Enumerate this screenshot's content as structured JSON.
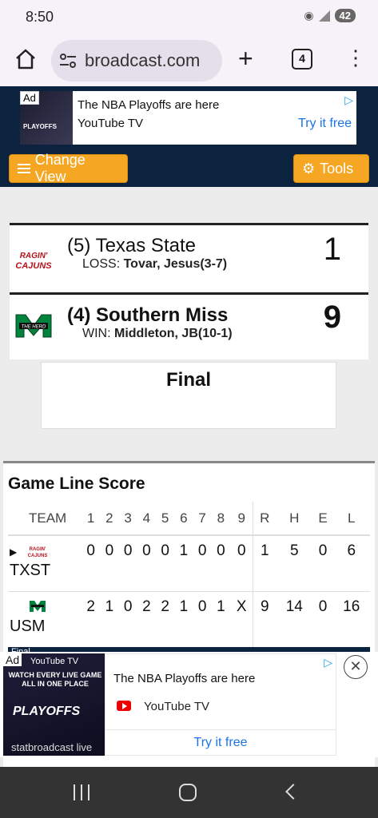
{
  "status": {
    "time": "8:50",
    "battery": "42"
  },
  "browser": {
    "url": "broadcast.com",
    "tab_count": "4"
  },
  "top_ad": {
    "tag": "Ad",
    "headline": "The NBA Playoffs are here",
    "brand": "YouTube TV",
    "cta": "Try it free"
  },
  "toolbar": {
    "change_view": "Change View",
    "tools": "Tools"
  },
  "game": {
    "team1": {
      "rank_name": "(5) Texas State",
      "decision_label": "LOSS:",
      "decision_pitcher": "Tovar, Jesus(3-7)",
      "score": "1",
      "logo_text": "RAGIN' CAJUNS"
    },
    "team2": {
      "rank_name": "(4) Southern Miss",
      "decision_label": "WIN:",
      "decision_pitcher": "Middleton, JB(10-1)",
      "score": "9",
      "logo_text": "THE HERD"
    },
    "status": "Final"
  },
  "line_score": {
    "title": "Game Line Score",
    "headers": [
      "TEAM",
      "1",
      "2",
      "3",
      "4",
      "5",
      "6",
      "7",
      "8",
      "9",
      "R",
      "H",
      "E",
      "L"
    ],
    "rows": [
      {
        "abbr": "TXST",
        "innings": [
          "0",
          "0",
          "0",
          "0",
          "0",
          "1",
          "0",
          "0",
          "0"
        ],
        "r": "1",
        "h": "5",
        "e": "0",
        "l": "6"
      },
      {
        "abbr": "USM",
        "innings": [
          "2",
          "1",
          "0",
          "2",
          "2",
          "1",
          "0",
          "1",
          "X"
        ],
        "r": "9",
        "h": "14",
        "e": "0",
        "l": "16"
      }
    ],
    "footer": "Final"
  },
  "bottom_ad": {
    "tag": "Ad",
    "thumb_brand": "YouTube TV",
    "thumb_line": "WATCH EVERY LIVE GAME ALL IN ONE PLACE",
    "thumb_logo": "PLAYOFFS",
    "watermark": "statbroadcast live",
    "headline": "The NBA Playoffs are here",
    "brand": "YouTube TV",
    "cta": "Try it free"
  }
}
